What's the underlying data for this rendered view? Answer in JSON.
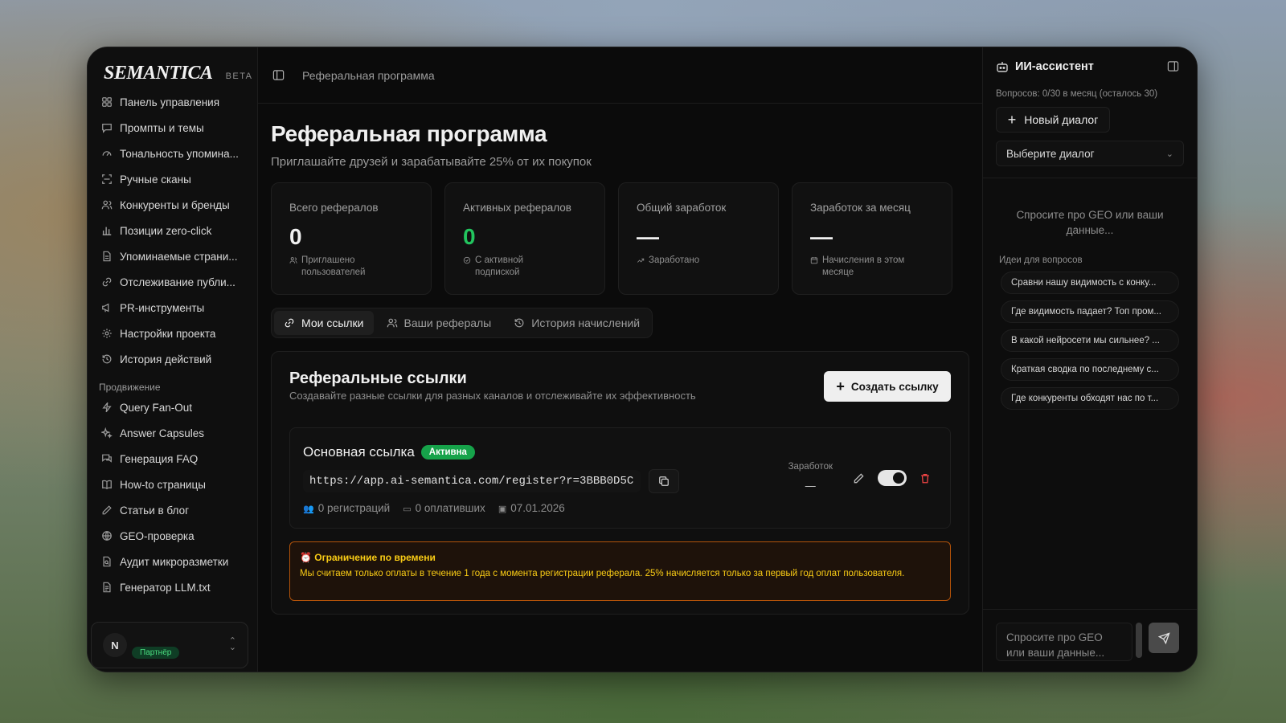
{
  "brand": {
    "logo": "SEMANTICA",
    "beta": "BETA"
  },
  "sidebar": {
    "items": [
      {
        "label": "Панель управления",
        "icon": "dashboard-icon"
      },
      {
        "label": "Промпты и темы",
        "icon": "message-icon"
      },
      {
        "label": "Тональность упомина...",
        "icon": "gauge-icon"
      },
      {
        "label": "Ручные сканы",
        "icon": "scan-icon"
      },
      {
        "label": "Конкуренты и бренды",
        "icon": "users-icon"
      },
      {
        "label": "Позиции zero-click",
        "icon": "bar-chart-icon"
      },
      {
        "label": "Упоминаемые страни...",
        "icon": "file-icon"
      },
      {
        "label": "Отслеживание публи...",
        "icon": "link-icon"
      },
      {
        "label": "PR-инструменты",
        "icon": "megaphone-icon"
      },
      {
        "label": "Настройки проекта",
        "icon": "gear-icon"
      },
      {
        "label": "История действий",
        "icon": "history-icon"
      }
    ],
    "promo_label": "Продвижение",
    "promo_items": [
      {
        "label": "Query Fan-Out",
        "icon": "bolt-icon"
      },
      {
        "label": "Answer Capsules",
        "icon": "sparkles-icon"
      },
      {
        "label": "Генерация FAQ",
        "icon": "chat-icon"
      },
      {
        "label": "How-to страницы",
        "icon": "book-icon"
      },
      {
        "label": "Статьи в блог",
        "icon": "pencil-icon"
      },
      {
        "label": "GEO-проверка",
        "icon": "globe-icon"
      },
      {
        "label": "Аудит микроразметки",
        "icon": "file-search-icon"
      },
      {
        "label": "Генератор LLM.txt",
        "icon": "file-text-icon"
      }
    ],
    "user": {
      "initial": "N",
      "badge": "Партнёр"
    }
  },
  "topbar": {
    "breadcrumb": "Реферальная программа"
  },
  "page": {
    "title": "Реферальная программа",
    "subtitle": "Приглашайте друзей и зарабатывайте 25% от их покупок"
  },
  "stats": [
    {
      "label": "Всего рефералов",
      "value": "0",
      "note": "Приглашено пользователей",
      "icon": "users-icon"
    },
    {
      "label": "Активных рефералов",
      "value": "0",
      "note": "С активной подпиской",
      "icon": "check-circle-icon"
    },
    {
      "label": "Общий заработок",
      "value": "—",
      "note": "Заработано",
      "icon": "trend-icon"
    },
    {
      "label": "Заработок за месяц",
      "value": "—",
      "note": "Начисления в этом месяце",
      "icon": "calendar-icon"
    }
  ],
  "tabs": [
    {
      "label": "Мои ссылки",
      "icon": "link-icon"
    },
    {
      "label": "Ваши рефералы",
      "icon": "users-icon"
    },
    {
      "label": "История начислений",
      "icon": "history-icon"
    }
  ],
  "links_section": {
    "title": "Реферальные ссылки",
    "subtitle": "Создавайте разные ссылки для разных каналов и отслеживайте их эффективность",
    "create_label": "Создать ссылку",
    "link": {
      "name": "Основная ссылка",
      "status": "Активна",
      "url": "https://app.ai-semantica.com/register?r=3BBB0D5C",
      "registrations": "0 регистраций",
      "paying": "0 оплативших",
      "date": "07.01.2026",
      "earn_label": "Заработок",
      "earn_value": "—",
      "enabled": true
    },
    "warning_title": "Ограничение по времени",
    "warning_text": "Мы считаем только оплаты в течение 1 года с момента регистрации реферала. 25% начисляется только за первый год оплат пользователя."
  },
  "ai": {
    "title": "ИИ-ассистент",
    "quota": "Вопросов: 0/30 в месяц (осталось 30)",
    "new_dialog": "Новый диалог",
    "select_dialog": "Выберите диалог",
    "empty_text": "Спросите про GEO или ваши данные...",
    "ideas_label": "Идеи для вопросов",
    "ideas": [
      "Сравни нашу видимость с конку...",
      "Где видимость падает? Топ пром...",
      "В какой нейросети мы сильнее? ...",
      "Краткая сводка по последнему с...",
      "Где конкуренты обходят нас по т..."
    ],
    "input_placeholder": "Спросите про GEO или ваши данные..."
  },
  "colors": {
    "accent_green": "#22c55e",
    "warning": "#facc15",
    "danger": "#ef4444"
  }
}
